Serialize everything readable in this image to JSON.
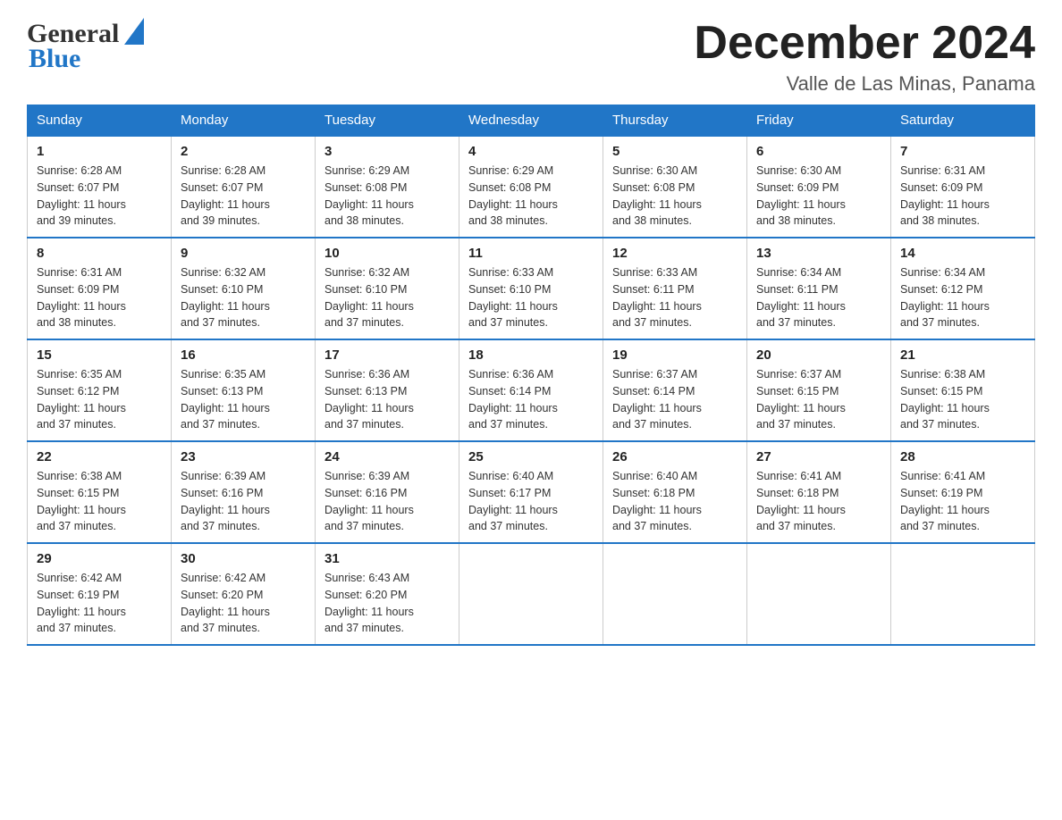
{
  "header": {
    "logo_general": "General",
    "logo_blue": "Blue",
    "month_title": "December 2024",
    "location": "Valle de Las Minas, Panama"
  },
  "weekdays": [
    "Sunday",
    "Monday",
    "Tuesday",
    "Wednesday",
    "Thursday",
    "Friday",
    "Saturday"
  ],
  "weeks": [
    [
      {
        "day": "1",
        "sunrise": "6:28 AM",
        "sunset": "6:07 PM",
        "daylight": "11 hours and 39 minutes."
      },
      {
        "day": "2",
        "sunrise": "6:28 AM",
        "sunset": "6:07 PM",
        "daylight": "11 hours and 39 minutes."
      },
      {
        "day": "3",
        "sunrise": "6:29 AM",
        "sunset": "6:08 PM",
        "daylight": "11 hours and 38 minutes."
      },
      {
        "day": "4",
        "sunrise": "6:29 AM",
        "sunset": "6:08 PM",
        "daylight": "11 hours and 38 minutes."
      },
      {
        "day": "5",
        "sunrise": "6:30 AM",
        "sunset": "6:08 PM",
        "daylight": "11 hours and 38 minutes."
      },
      {
        "day": "6",
        "sunrise": "6:30 AM",
        "sunset": "6:09 PM",
        "daylight": "11 hours and 38 minutes."
      },
      {
        "day": "7",
        "sunrise": "6:31 AM",
        "sunset": "6:09 PM",
        "daylight": "11 hours and 38 minutes."
      }
    ],
    [
      {
        "day": "8",
        "sunrise": "6:31 AM",
        "sunset": "6:09 PM",
        "daylight": "11 hours and 38 minutes."
      },
      {
        "day": "9",
        "sunrise": "6:32 AM",
        "sunset": "6:10 PM",
        "daylight": "11 hours and 37 minutes."
      },
      {
        "day": "10",
        "sunrise": "6:32 AM",
        "sunset": "6:10 PM",
        "daylight": "11 hours and 37 minutes."
      },
      {
        "day": "11",
        "sunrise": "6:33 AM",
        "sunset": "6:10 PM",
        "daylight": "11 hours and 37 minutes."
      },
      {
        "day": "12",
        "sunrise": "6:33 AM",
        "sunset": "6:11 PM",
        "daylight": "11 hours and 37 minutes."
      },
      {
        "day": "13",
        "sunrise": "6:34 AM",
        "sunset": "6:11 PM",
        "daylight": "11 hours and 37 minutes."
      },
      {
        "day": "14",
        "sunrise": "6:34 AM",
        "sunset": "6:12 PM",
        "daylight": "11 hours and 37 minutes."
      }
    ],
    [
      {
        "day": "15",
        "sunrise": "6:35 AM",
        "sunset": "6:12 PM",
        "daylight": "11 hours and 37 minutes."
      },
      {
        "day": "16",
        "sunrise": "6:35 AM",
        "sunset": "6:13 PM",
        "daylight": "11 hours and 37 minutes."
      },
      {
        "day": "17",
        "sunrise": "6:36 AM",
        "sunset": "6:13 PM",
        "daylight": "11 hours and 37 minutes."
      },
      {
        "day": "18",
        "sunrise": "6:36 AM",
        "sunset": "6:14 PM",
        "daylight": "11 hours and 37 minutes."
      },
      {
        "day": "19",
        "sunrise": "6:37 AM",
        "sunset": "6:14 PM",
        "daylight": "11 hours and 37 minutes."
      },
      {
        "day": "20",
        "sunrise": "6:37 AM",
        "sunset": "6:15 PM",
        "daylight": "11 hours and 37 minutes."
      },
      {
        "day": "21",
        "sunrise": "6:38 AM",
        "sunset": "6:15 PM",
        "daylight": "11 hours and 37 minutes."
      }
    ],
    [
      {
        "day": "22",
        "sunrise": "6:38 AM",
        "sunset": "6:15 PM",
        "daylight": "11 hours and 37 minutes."
      },
      {
        "day": "23",
        "sunrise": "6:39 AM",
        "sunset": "6:16 PM",
        "daylight": "11 hours and 37 minutes."
      },
      {
        "day": "24",
        "sunrise": "6:39 AM",
        "sunset": "6:16 PM",
        "daylight": "11 hours and 37 minutes."
      },
      {
        "day": "25",
        "sunrise": "6:40 AM",
        "sunset": "6:17 PM",
        "daylight": "11 hours and 37 minutes."
      },
      {
        "day": "26",
        "sunrise": "6:40 AM",
        "sunset": "6:18 PM",
        "daylight": "11 hours and 37 minutes."
      },
      {
        "day": "27",
        "sunrise": "6:41 AM",
        "sunset": "6:18 PM",
        "daylight": "11 hours and 37 minutes."
      },
      {
        "day": "28",
        "sunrise": "6:41 AM",
        "sunset": "6:19 PM",
        "daylight": "11 hours and 37 minutes."
      }
    ],
    [
      {
        "day": "29",
        "sunrise": "6:42 AM",
        "sunset": "6:19 PM",
        "daylight": "11 hours and 37 minutes."
      },
      {
        "day": "30",
        "sunrise": "6:42 AM",
        "sunset": "6:20 PM",
        "daylight": "11 hours and 37 minutes."
      },
      {
        "day": "31",
        "sunrise": "6:43 AM",
        "sunset": "6:20 PM",
        "daylight": "11 hours and 37 minutes."
      },
      null,
      null,
      null,
      null
    ]
  ],
  "labels": {
    "sunrise": "Sunrise:",
    "sunset": "Sunset:",
    "daylight": "Daylight:"
  }
}
